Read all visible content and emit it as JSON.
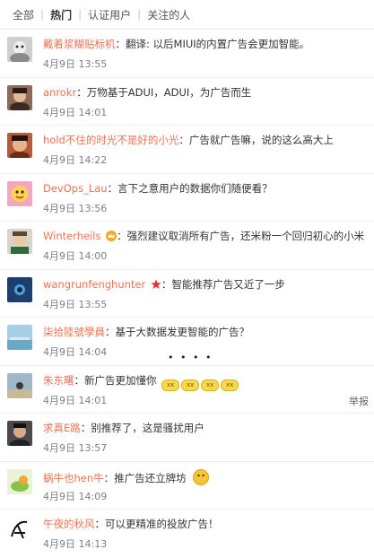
{
  "tabs": [
    "全部",
    "热门",
    "认证用户",
    "关注的人"
  ],
  "active_tab": "热门",
  "report_label": "举报",
  "comments": [
    {
      "user": "戴着浆糊贴标机",
      "text": "翻译: 以后MIUI的内置广告会更加智能。",
      "time": "4月9日 13:55"
    },
    {
      "user": "anrokr",
      "text": "万物基于ADUI，ADUI，为广告而生",
      "time": "4月9日 14:01"
    },
    {
      "user": "hold不住的时光不是好的小光",
      "text": "广告就广告嘛，说的这么高大上",
      "time": "4月9日 14:22"
    },
    {
      "user": "DevOps_Lau",
      "text": "言下之意用户的数据你们随便看？",
      "time": "4月9日 13:56"
    },
    {
      "user": "Winterheils",
      "text": "强烈建议取消所有广告，还米粉一个回归初心的小米",
      "time": "4月9日 14:00"
    },
    {
      "user": "wangrunfenghunter",
      "text": "智能推荐广告又近了一步",
      "time": "4月9日 13:55"
    },
    {
      "user": "柒拾陸號學員",
      "text": "基于大数据发更智能的广告？",
      "time": "4月9日 14:04"
    },
    {
      "user": "朱东曙",
      "text": "新广告更加懂你",
      "time": "4月9日 14:01"
    },
    {
      "user": "求真E路",
      "text": "别推荐了，这是骚扰用户",
      "time": "4月9日 13:57"
    },
    {
      "user": "蜗牛也hen牛",
      "text": "推广告还立牌坊",
      "time": "4月9日 14:09"
    },
    {
      "user": "午夜的秋风",
      "text": "可以更精准的投放广告！",
      "time": "4月9日 14:13"
    }
  ],
  "emoji_labels": [
    "xx",
    "xx",
    "xx",
    "xx"
  ],
  "emoji_dots": "•  •  •  •",
  "colors": {
    "username": "#eb7350",
    "text": "#333333",
    "time": "#808080"
  },
  "icons": {
    "badge_winterheils": "vip-crown-icon",
    "badge_wang": "red-star-icon",
    "emoji_snail": "smiley-emoji-icon"
  }
}
